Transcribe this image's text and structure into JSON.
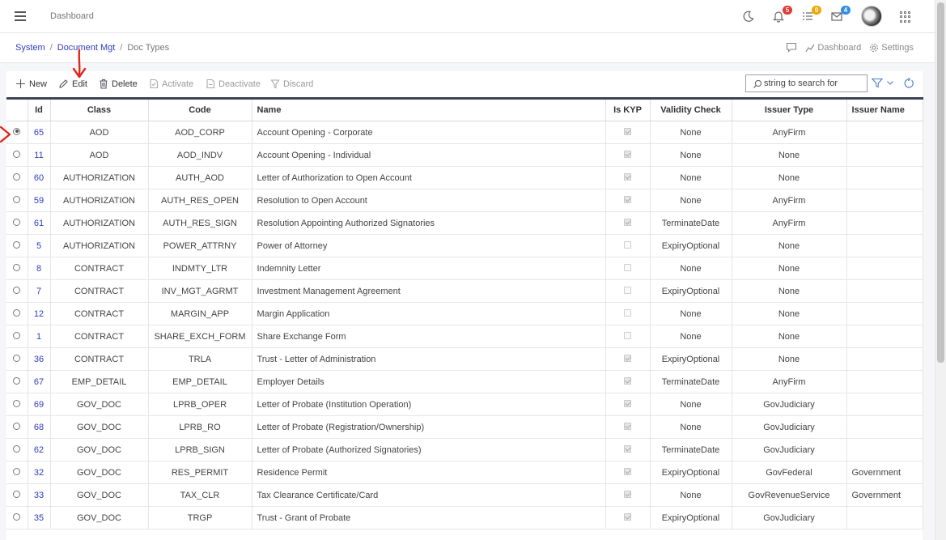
{
  "header": {
    "title": "Dashboard",
    "notifications_count": "5",
    "tasks_count": "0",
    "messages_count": "4"
  },
  "breadcrumb": {
    "items": [
      "System",
      "Document Mgt",
      "Doc Types"
    ],
    "actions": {
      "dashboard": "Dashboard",
      "settings": "Settings"
    }
  },
  "toolbar": {
    "new": "New",
    "edit": "Edit",
    "delete": "Delete",
    "activate": "Activate",
    "deactivate": "Deactivate",
    "discard": "Discard",
    "search_placeholder": "string to search for"
  },
  "table": {
    "columns": [
      "Id",
      "Class",
      "Code",
      "Name",
      "Is KYP",
      "Validity Check",
      "Issuer Type",
      "Issuer Name"
    ],
    "rows": [
      {
        "selected": true,
        "id": "65",
        "class": "AOD",
        "code": "AOD_CORP",
        "name": "Account Opening - Corporate",
        "kyp": true,
        "validity": "None",
        "issuer_type": "AnyFirm",
        "issuer_name": ""
      },
      {
        "selected": false,
        "id": "11",
        "class": "AOD",
        "code": "AOD_INDV",
        "name": "Account Opening - Individual",
        "kyp": true,
        "validity": "None",
        "issuer_type": "None",
        "issuer_name": ""
      },
      {
        "selected": false,
        "id": "60",
        "class": "AUTHORIZATION",
        "code": "AUTH_AOD",
        "name": "Letter of Authorization to Open Account",
        "kyp": true,
        "validity": "None",
        "issuer_type": "None",
        "issuer_name": ""
      },
      {
        "selected": false,
        "id": "59",
        "class": "AUTHORIZATION",
        "code": "AUTH_RES_OPEN",
        "name": "Resolution to Open Account",
        "kyp": true,
        "validity": "None",
        "issuer_type": "AnyFirm",
        "issuer_name": ""
      },
      {
        "selected": false,
        "id": "61",
        "class": "AUTHORIZATION",
        "code": "AUTH_RES_SIGN",
        "name": "Resolution Appointing Authorized Signatories",
        "kyp": true,
        "validity": "TerminateDate",
        "issuer_type": "AnyFirm",
        "issuer_name": ""
      },
      {
        "selected": false,
        "id": "5",
        "class": "AUTHORIZATION",
        "code": "POWER_ATTRNY",
        "name": "Power of Attorney",
        "kyp": false,
        "validity": "ExpiryOptional",
        "issuer_type": "None",
        "issuer_name": ""
      },
      {
        "selected": false,
        "id": "8",
        "class": "CONTRACT",
        "code": "INDMTY_LTR",
        "name": "Indemnity Letter",
        "kyp": false,
        "validity": "None",
        "issuer_type": "None",
        "issuer_name": ""
      },
      {
        "selected": false,
        "id": "7",
        "class": "CONTRACT",
        "code": "INV_MGT_AGRMT",
        "name": "Investment Management Agreement",
        "kyp": false,
        "validity": "ExpiryOptional",
        "issuer_type": "None",
        "issuer_name": ""
      },
      {
        "selected": false,
        "id": "12",
        "class": "CONTRACT",
        "code": "MARGIN_APP",
        "name": "Margin Application",
        "kyp": false,
        "validity": "None",
        "issuer_type": "None",
        "issuer_name": ""
      },
      {
        "selected": false,
        "id": "1",
        "class": "CONTRACT",
        "code": "SHARE_EXCH_FORM",
        "name": "Share Exchange Form",
        "kyp": false,
        "validity": "None",
        "issuer_type": "None",
        "issuer_name": ""
      },
      {
        "selected": false,
        "id": "36",
        "class": "CONTRACT",
        "code": "TRLA",
        "name": "Trust - Letter of Administration",
        "kyp": true,
        "validity": "ExpiryOptional",
        "issuer_type": "None",
        "issuer_name": ""
      },
      {
        "selected": false,
        "id": "67",
        "class": "EMP_DETAIL",
        "code": "EMP_DETAIL",
        "name": "Employer Details",
        "kyp": true,
        "validity": "TerminateDate",
        "issuer_type": "AnyFirm",
        "issuer_name": ""
      },
      {
        "selected": false,
        "id": "69",
        "class": "GOV_DOC",
        "code": "LPRB_OPER",
        "name": "Letter of Probate (Institution Operation)",
        "kyp": true,
        "validity": "None",
        "issuer_type": "GovJudiciary",
        "issuer_name": ""
      },
      {
        "selected": false,
        "id": "68",
        "class": "GOV_DOC",
        "code": "LPRB_RO",
        "name": "Letter of Probate (Registration/Ownership)",
        "kyp": true,
        "validity": "None",
        "issuer_type": "GovJudiciary",
        "issuer_name": ""
      },
      {
        "selected": false,
        "id": "62",
        "class": "GOV_DOC",
        "code": "LPRB_SIGN",
        "name": "Letter of Probate (Authorized Signatories)",
        "kyp": true,
        "validity": "TerminateDate",
        "issuer_type": "GovJudiciary",
        "issuer_name": ""
      },
      {
        "selected": false,
        "id": "32",
        "class": "GOV_DOC",
        "code": "RES_PERMIT",
        "name": "Residence Permit",
        "kyp": true,
        "validity": "ExpiryOptional",
        "issuer_type": "GovFederal",
        "issuer_name": "Government"
      },
      {
        "selected": false,
        "id": "33",
        "class": "GOV_DOC",
        "code": "TAX_CLR",
        "name": "Tax Clearance Certificate/Card",
        "kyp": true,
        "validity": "None",
        "issuer_type": "GovRevenueService",
        "issuer_name": "Government"
      },
      {
        "selected": false,
        "id": "35",
        "class": "GOV_DOC",
        "code": "TRGP",
        "name": "Trust - Grant of Probate",
        "kyp": true,
        "validity": "ExpiryOptional",
        "issuer_type": "GovJudiciary",
        "issuer_name": ""
      }
    ]
  },
  "colors": {
    "link": "#2e3dbf",
    "badge_red": "#e53935",
    "badge_amber": "#f0a800",
    "badge_blue": "#2f8ee6",
    "annotation_red": "#e0261b"
  }
}
